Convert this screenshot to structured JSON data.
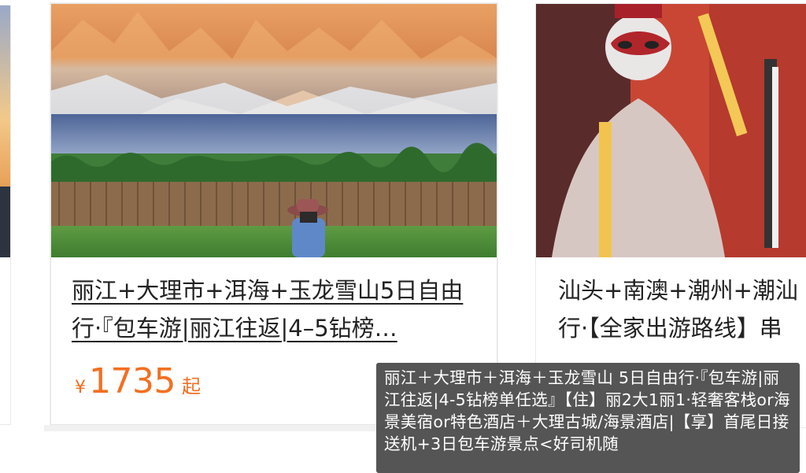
{
  "cards": [
    {
      "title": "",
      "price": null
    },
    {
      "title": "丽江+大理市+洱海+玉龙雪山5日自由行·『包车游|丽江往返|4–5钻榜…",
      "price": {
        "currency": "¥",
        "amount": "1735",
        "suffix": "起"
      }
    },
    {
      "title": "汕头+南澳+潮州+潮汕 行·【全家出游路线】串"
    }
  ],
  "tooltip": {
    "text": "丽江＋大理市＋洱海＋玉龙雪山 5日自由行·『包车游|丽江往返|4-5钻榜单任选』【住】丽2大1丽1·轻奢客栈or海景美宿or特色酒店＋大理古城/海景酒店|【享】首尾日接送机+3日包车游景点<好司机随"
  },
  "colors": {
    "price": "#f36f21",
    "tooltip_bg": "#484848",
    "title": "#222222"
  }
}
